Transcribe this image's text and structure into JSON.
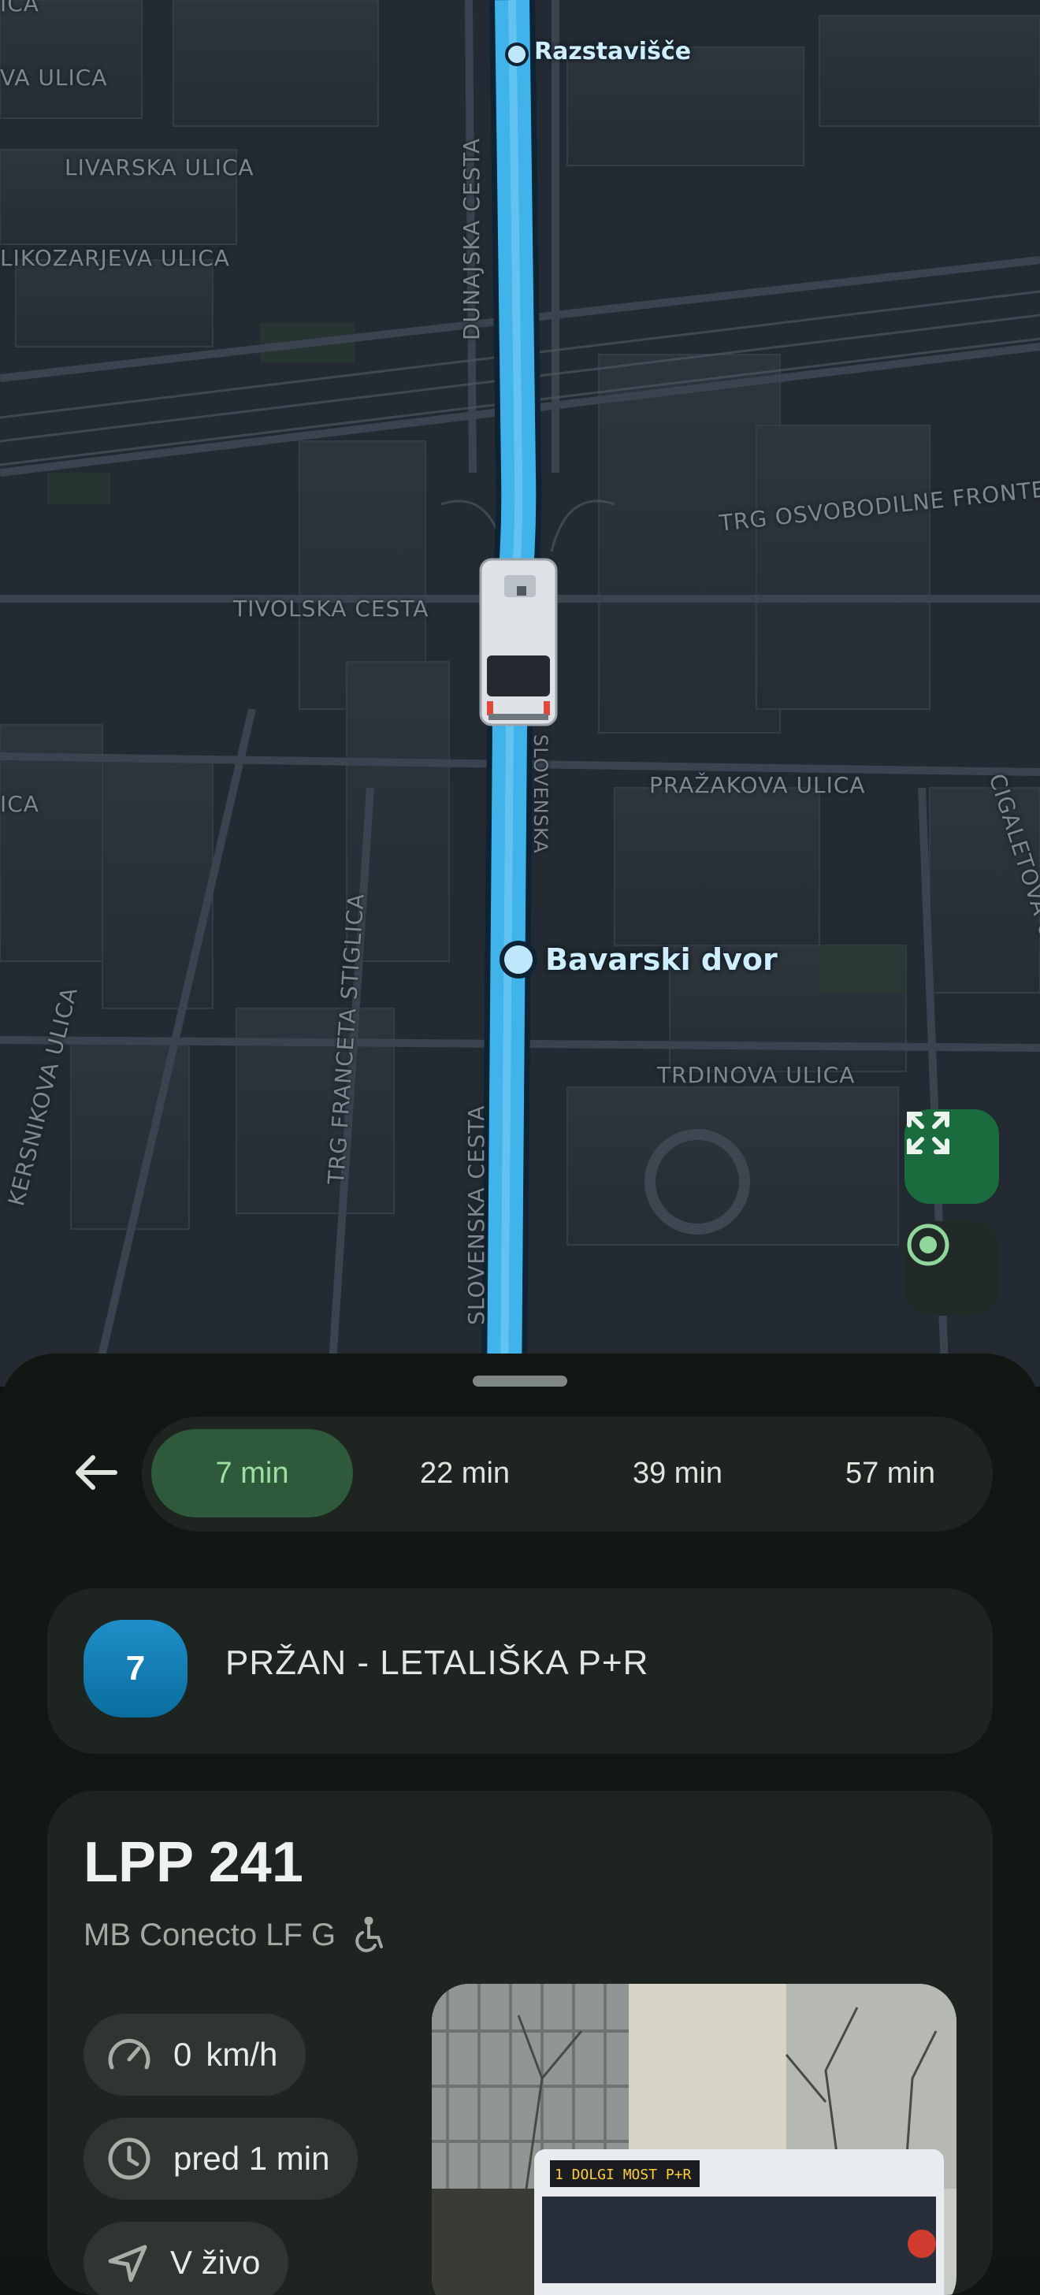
{
  "map": {
    "street_labels": {
      "top_left_cut": "ICA",
      "va_ulica": "VA ULICA",
      "livarska": "LIVARSKA ULICA",
      "likozarjeva": "LIKOZARJEVA ULICA",
      "dunajska": "DUNAJSKA CESTA",
      "trg_osvobodilne": "TRG OSVOBODILNE FRONTE",
      "tivolska": "TIVOLSKA CESTA",
      "prazakova": "PRAŽAKOVA ULICA",
      "cigaletova": "CIGALETOVA ULICA",
      "slovenska_upper": "SLOVENSKA",
      "ica_left": "ICA",
      "trg_franceta": "TRG FRANCETA STIGLICA",
      "kersnikova": "KERSNIKOVA ULICA",
      "slovenska_lower": "SLOVENSKA CESTA",
      "trdinova": "TRDINOVA ULICA"
    },
    "stops": [
      {
        "name": "Razstavišče"
      },
      {
        "name": "Bavarski dvor"
      }
    ],
    "route_color": "#3fb3ea",
    "controls": {
      "expand_icon": "fullscreen-icon",
      "locate_icon": "my-location-icon"
    }
  },
  "sheet": {
    "back_icon": "arrow-left-icon",
    "departures": [
      "7 min",
      "22 min",
      "39 min",
      "57 min"
    ],
    "selected_departure": 0,
    "route": {
      "number": "7",
      "name": "PRŽAN - LETALIŠKA P+R",
      "badge_color": "#1286c0"
    },
    "vehicle": {
      "title": "LPP 241",
      "model": "MB Conecto LF G",
      "accessibility_icon": "wheelchair-icon",
      "speed_value": "0",
      "speed_unit": "km/h",
      "last_update": "pred 1 min",
      "status": "V živo",
      "photo_sign": "1 DOLGI MOST P+R"
    }
  }
}
